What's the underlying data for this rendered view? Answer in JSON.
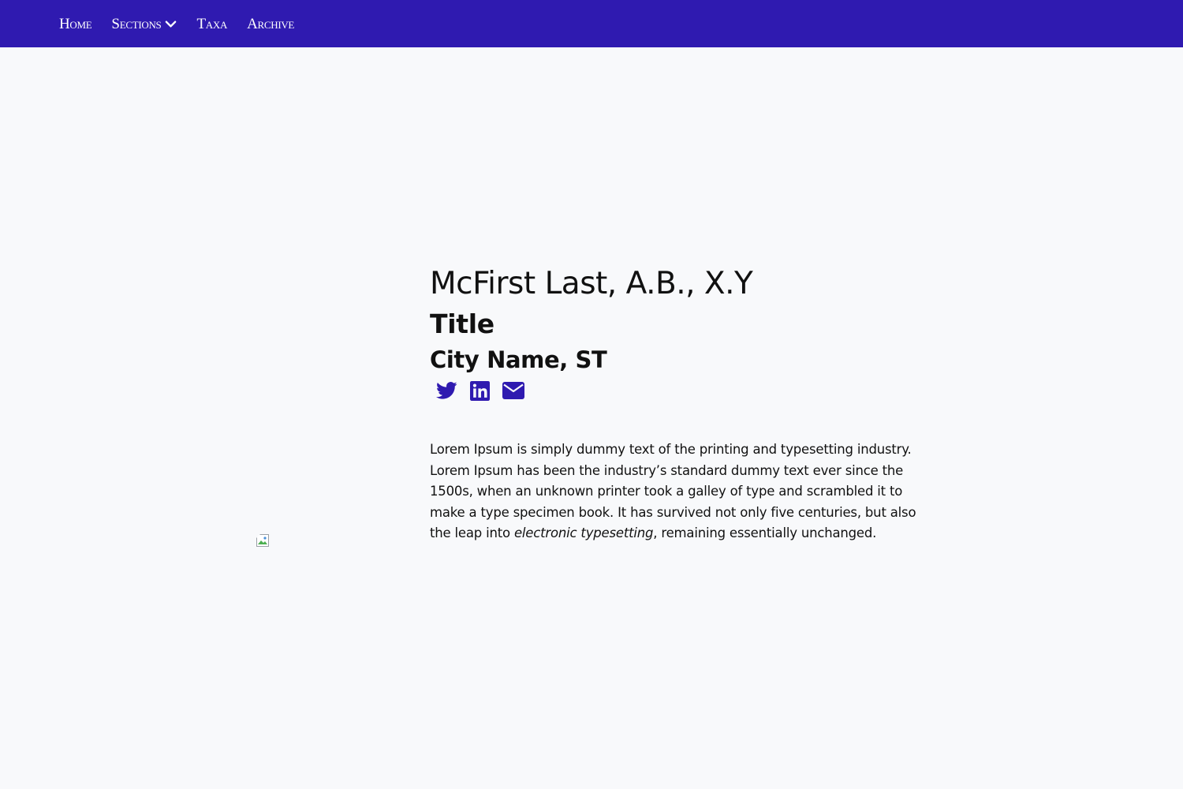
{
  "nav": {
    "items": [
      {
        "label": "Home"
      },
      {
        "label": "Sections",
        "has_dropdown": true
      },
      {
        "label": "Taxa"
      },
      {
        "label": "Archive"
      }
    ],
    "dropdown_icon": "chevron-down-icon"
  },
  "colors": {
    "navbar_bg": "#2f1ab0",
    "page_bg": "#f8f9fb",
    "icon_color": "#2f1ab0"
  },
  "profile": {
    "name": "McFirst Last, A.B., X.Y",
    "title": "Title",
    "location": "City Name, ST",
    "socials": [
      {
        "icon": "twitter-icon"
      },
      {
        "icon": "linkedin-icon"
      },
      {
        "icon": "envelope-icon"
      }
    ],
    "photo": "broken-image-icon",
    "bio_before": "Lorem Ipsum is simply dummy text of the printing and typesetting industry. Lorem Ipsum has been the industry’s standard dummy text ever since the 1500s, when an unknown printer took a galley of type and scrambled it to make a type specimen book. It has survived not only five centuries, but also the leap into ",
    "bio_emphasis": "electronic typesetting",
    "bio_after": ", remaining essentially unchanged."
  }
}
